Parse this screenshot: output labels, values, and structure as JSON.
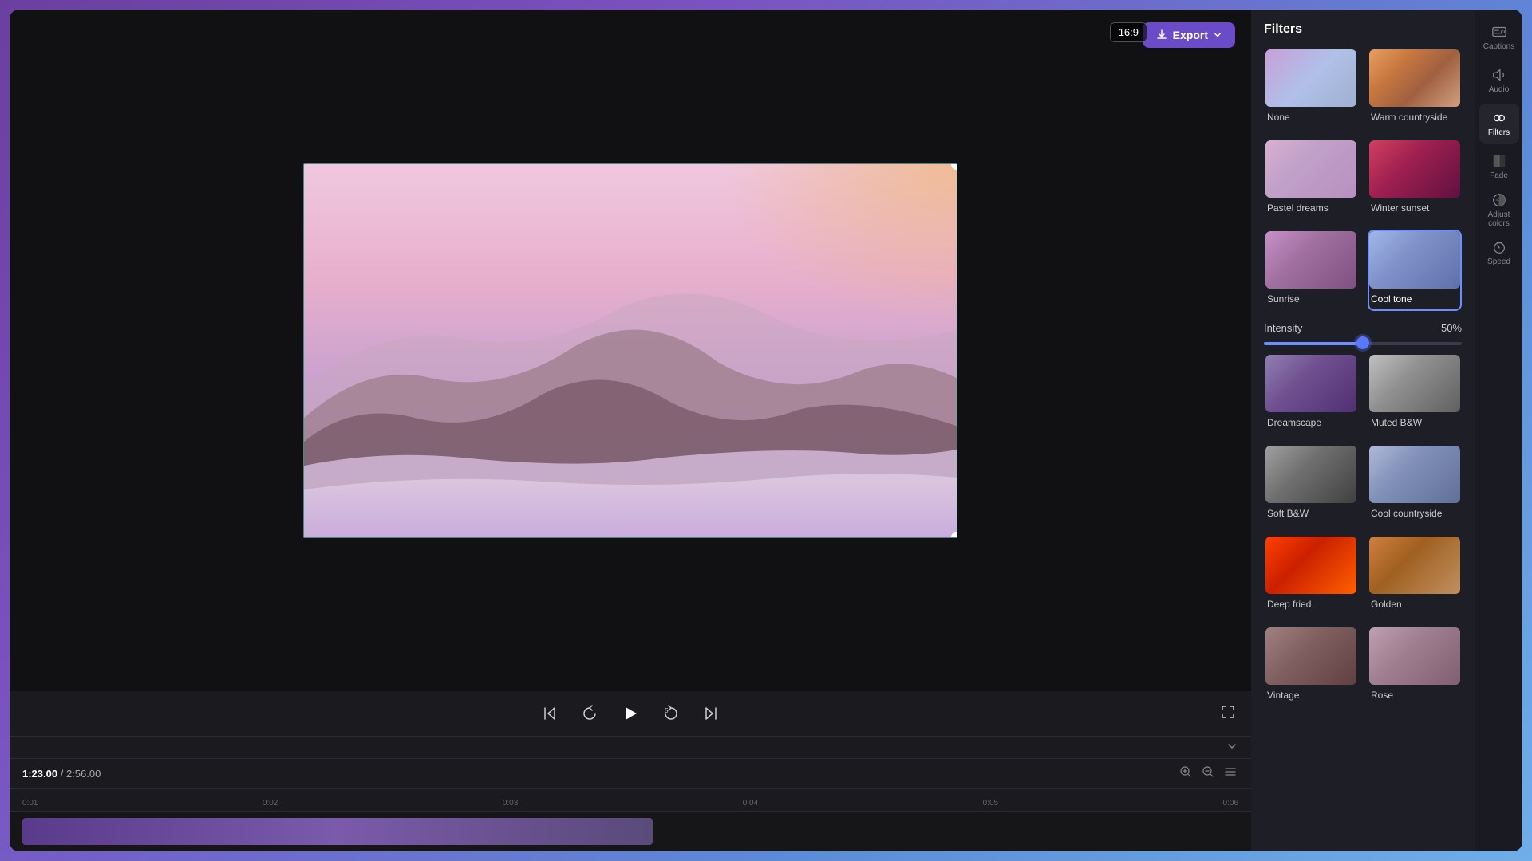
{
  "header": {
    "export_label": "Export"
  },
  "preview": {
    "aspect_ratio": "16:9",
    "time_current": "1:23.00",
    "time_total": "2:56.00"
  },
  "timeline": {
    "ruler_marks": [
      "0:01",
      "0:02",
      "0:03",
      "0:04",
      "0:05",
      "0:06"
    ]
  },
  "filters": {
    "title": "Filters",
    "intensity_label": "Intensity",
    "intensity_value": "50%",
    "items": [
      {
        "id": "none",
        "label": "None",
        "thumb_class": "thumb-none",
        "selected": false
      },
      {
        "id": "warm-countryside",
        "label": "Warm countryside",
        "thumb_class": "thumb-warm-countryside",
        "selected": false
      },
      {
        "id": "pastel-dreams",
        "label": "Pastel dreams",
        "thumb_class": "thumb-pastel-dreams",
        "selected": false
      },
      {
        "id": "winter-sunset",
        "label": "Winter sunset",
        "thumb_class": "thumb-winter-sunset",
        "selected": false
      },
      {
        "id": "sunrise",
        "label": "Sunrise",
        "thumb_class": "thumb-sunrise",
        "selected": false
      },
      {
        "id": "cool-tone",
        "label": "Cool tone",
        "thumb_class": "thumb-cool-tone",
        "selected": true
      },
      {
        "id": "dreamscape",
        "label": "Dreamscape",
        "thumb_class": "thumb-dreamscape",
        "selected": false
      },
      {
        "id": "muted-bw",
        "label": "Muted B&W",
        "thumb_class": "thumb-muted-bw",
        "selected": false
      },
      {
        "id": "soft-bw",
        "label": "Soft B&W",
        "thumb_class": "thumb-soft-bw",
        "selected": false
      },
      {
        "id": "cool-countryside",
        "label": "Cool countryside",
        "thumb_class": "thumb-cool-countryside",
        "selected": false
      },
      {
        "id": "deep-fried",
        "label": "Deep fried",
        "thumb_class": "thumb-deep-fried",
        "selected": false
      },
      {
        "id": "golden",
        "label": "Golden",
        "thumb_class": "thumb-golden",
        "selected": false
      },
      {
        "id": "last1",
        "label": "Vintage",
        "thumb_class": "thumb-last1",
        "selected": false
      },
      {
        "id": "last2",
        "label": "Rose",
        "thumb_class": "thumb-last2",
        "selected": false
      }
    ]
  },
  "sidebar": {
    "items": [
      {
        "id": "captions",
        "label": "Captions",
        "icon": "cc"
      },
      {
        "id": "audio",
        "label": "Audio",
        "icon": "audio"
      },
      {
        "id": "filters",
        "label": "Filters",
        "icon": "filters",
        "active": true
      },
      {
        "id": "fade",
        "label": "Fade",
        "icon": "fade"
      },
      {
        "id": "adjust-colors",
        "label": "Adjust colors",
        "icon": "adjust"
      },
      {
        "id": "speed",
        "label": "Speed",
        "icon": "speed"
      }
    ]
  },
  "controls": {
    "skip_back": "⏮",
    "rewind": "↺",
    "play": "▶",
    "forward5": "5",
    "skip_forward": "⏭"
  }
}
